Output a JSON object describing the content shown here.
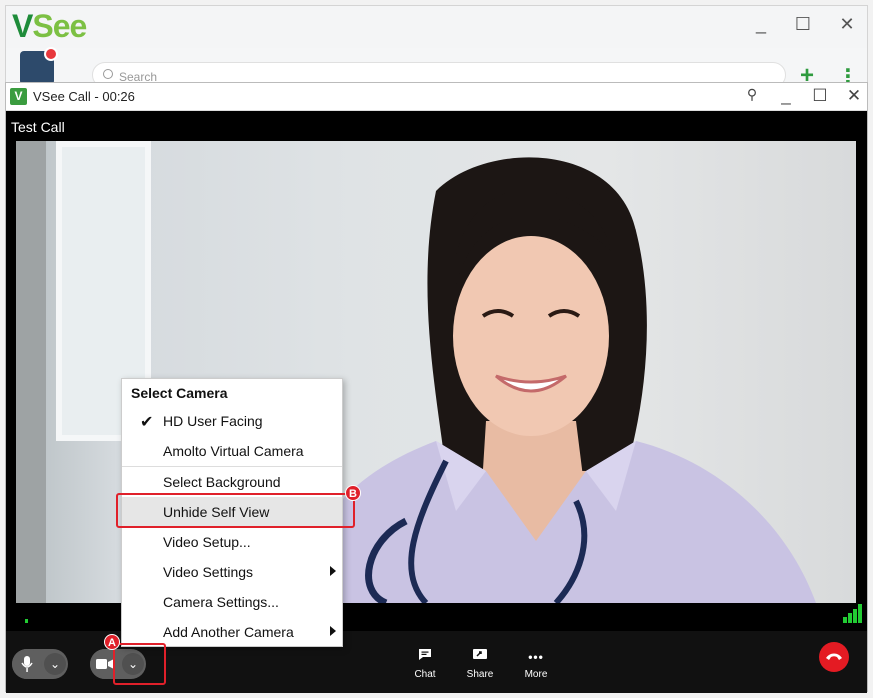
{
  "main_window": {
    "logo_v": "V",
    "logo_see": "See",
    "search_placeholder": "Search",
    "plus_label": "+",
    "kebab_label": "⋮",
    "controls": [
      "_",
      "☐",
      "✕"
    ]
  },
  "call_window": {
    "app_icon": "V",
    "title": "VSee Call - 00:26",
    "controls": [
      "⚲",
      "_",
      "☐",
      "✕"
    ],
    "call_name": "Test Call"
  },
  "toolbar": {
    "chat_label": "Chat",
    "share_label": "Share",
    "more_label": "More",
    "more_icon": "•••",
    "chevron": "⌄"
  },
  "camera_menu": {
    "header": "Select Camera",
    "checkmark": "✔",
    "items": [
      {
        "label": "HD User Facing",
        "checked": true
      },
      {
        "label": "Amolto Virtual Camera"
      },
      {
        "label": "Select Background"
      },
      {
        "label": "Unhide Self View",
        "highlighted": true
      },
      {
        "label": "Video Setup..."
      },
      {
        "label": "Video Settings",
        "submenu": true
      },
      {
        "label": "Camera Settings..."
      },
      {
        "label": "Add Another Camera",
        "submenu": true
      }
    ]
  },
  "annotations": {
    "a": "A",
    "b": "B"
  },
  "colors": {
    "brand_green": "#3a9c3f",
    "hangup_red": "#e41b23",
    "annotation_red": "#e0202a",
    "signal_green": "#22cc33"
  }
}
